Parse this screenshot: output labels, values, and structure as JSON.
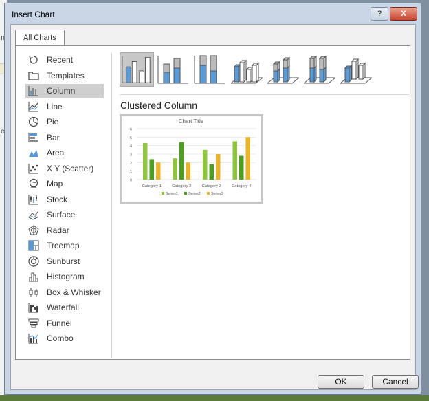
{
  "window": {
    "title": "Insert Chart",
    "help_label": "?",
    "close_label": "X"
  },
  "tabs": [
    {
      "label": "All Charts"
    }
  ],
  "sidebar": {
    "selected": "Column",
    "items": [
      {
        "label": "Recent",
        "icon": "recent-icon"
      },
      {
        "label": "Templates",
        "icon": "templates-icon"
      },
      {
        "label": "Column",
        "icon": "column-chart-icon"
      },
      {
        "label": "Line",
        "icon": "line-chart-icon"
      },
      {
        "label": "Pie",
        "icon": "pie-chart-icon"
      },
      {
        "label": "Bar",
        "icon": "bar-chart-icon"
      },
      {
        "label": "Area",
        "icon": "area-chart-icon"
      },
      {
        "label": "X Y (Scatter)",
        "icon": "scatter-chart-icon"
      },
      {
        "label": "Map",
        "icon": "map-chart-icon"
      },
      {
        "label": "Stock",
        "icon": "stock-chart-icon"
      },
      {
        "label": "Surface",
        "icon": "surface-chart-icon"
      },
      {
        "label": "Radar",
        "icon": "radar-chart-icon"
      },
      {
        "label": "Treemap",
        "icon": "treemap-chart-icon"
      },
      {
        "label": "Sunburst",
        "icon": "sunburst-chart-icon"
      },
      {
        "label": "Histogram",
        "icon": "histogram-chart-icon"
      },
      {
        "label": "Box & Whisker",
        "icon": "box-whisker-chart-icon"
      },
      {
        "label": "Waterfall",
        "icon": "waterfall-chart-icon"
      },
      {
        "label": "Funnel",
        "icon": "funnel-chart-icon"
      },
      {
        "label": "Combo",
        "icon": "combo-chart-icon"
      }
    ]
  },
  "subtypes": {
    "selected_title": "Clustered Column",
    "items": [
      {
        "icon": "clustered-column-icon"
      },
      {
        "icon": "stacked-column-icon"
      },
      {
        "icon": "100-stacked-column-icon"
      },
      {
        "icon": "3d-clustered-column-icon"
      },
      {
        "icon": "3d-stacked-column-icon"
      },
      {
        "icon": "3d-100-stacked-column-icon"
      },
      {
        "icon": "3d-column-icon"
      }
    ]
  },
  "chart_data": {
    "type": "bar",
    "title": "Chart Title",
    "categories": [
      "Category 1",
      "Category 2",
      "Category 3",
      "Category 4"
    ],
    "series": [
      {
        "name": "Series1",
        "values": [
          4.3,
          2.5,
          3.5,
          4.5
        ],
        "color": "#8fc43e"
      },
      {
        "name": "Series2",
        "values": [
          2.4,
          4.4,
          1.8,
          2.8
        ],
        "color": "#4f9e22"
      },
      {
        "name": "Series3",
        "values": [
          2,
          2,
          3,
          5
        ],
        "color": "#e9b32b"
      }
    ],
    "ylim": [
      0,
      6
    ],
    "yticks": [
      "0",
      "1",
      "2",
      "3",
      "4",
      "5",
      "6"
    ],
    "grid": true,
    "legend": "bottom"
  },
  "footer": {
    "ok_label": "OK",
    "cancel_label": "Cancel"
  },
  "colors": {
    "accent_blue": "#5b9bd5",
    "selection_gray": "#c7c7c7"
  },
  "background": {
    "left_letter": "n",
    "left_strip": "es"
  }
}
